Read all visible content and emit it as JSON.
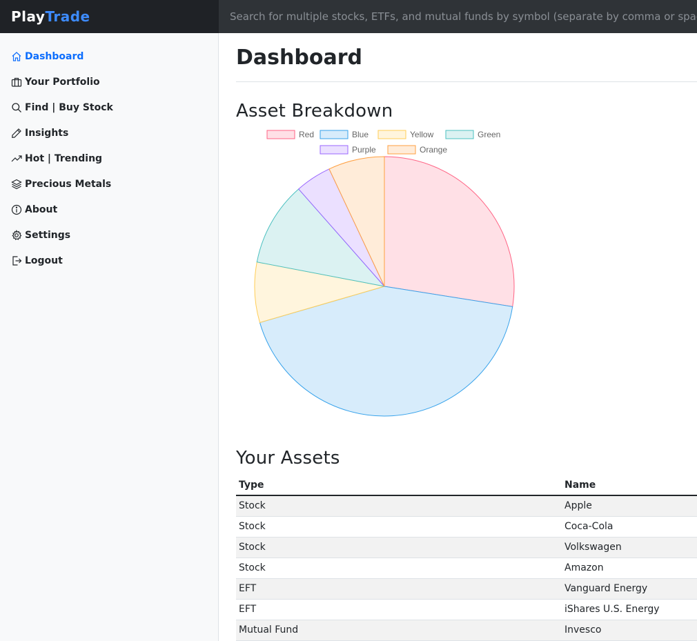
{
  "brand": {
    "part1": "Play",
    "part2": "Trade"
  },
  "search": {
    "placeholder": "Search for multiple stocks, ETFs, and mutual funds by symbol (separate by comma or space)"
  },
  "sidebar": {
    "items": [
      {
        "label": "Dashboard",
        "icon": "house-icon"
      },
      {
        "label": "Your Portfolio",
        "icon": "briefcase-icon"
      },
      {
        "label": "Find | Buy Stock",
        "icon": "search-icon"
      },
      {
        "label": "Insights",
        "icon": "pen-icon"
      },
      {
        "label": "Hot | Trending",
        "icon": "trending-up-icon"
      },
      {
        "label": "Precious Metals",
        "icon": "layers-icon"
      },
      {
        "label": "About",
        "icon": "info-icon"
      },
      {
        "label": "Settings",
        "icon": "gear-icon"
      },
      {
        "label": "Logout",
        "icon": "logout-icon"
      }
    ],
    "active_index": 0
  },
  "main": {
    "title": "Dashboard",
    "breakdown_title": "Asset Breakdown",
    "assets_title": "Your Assets"
  },
  "chart_data": {
    "type": "pie",
    "categories": [
      "Red",
      "Blue",
      "Yellow",
      "Green",
      "Purple",
      "Orange"
    ],
    "values": [
      27.5,
      43,
      7.5,
      10.5,
      4.5,
      7
    ],
    "colors": {
      "Red": {
        "fill": "#ffe0e6",
        "stroke": "#ff6384"
      },
      "Blue": {
        "fill": "#d7ecfb",
        "stroke": "#36a2eb"
      },
      "Yellow": {
        "fill": "#fff5dd",
        "stroke": "#ffcd56"
      },
      "Green": {
        "fill": "#dbf2f2",
        "stroke": "#4bc0c0"
      },
      "Purple": {
        "fill": "#ebe0ff",
        "stroke": "#9966ff"
      },
      "Orange": {
        "fill": "#ffecd9",
        "stroke": "#ff9f40"
      }
    },
    "legend_position": "top"
  },
  "table": {
    "headers": [
      "Type",
      "Name"
    ],
    "rows": [
      [
        "Stock",
        "Apple"
      ],
      [
        "Stock",
        "Coca-Cola"
      ],
      [
        "Stock",
        "Volkswagen"
      ],
      [
        "Stock",
        "Amazon"
      ],
      [
        "EFT",
        "Vanguard Energy"
      ],
      [
        "EFT",
        "iShares U.S. Energy"
      ],
      [
        "Mutual Fund",
        "Invesco"
      ]
    ]
  }
}
